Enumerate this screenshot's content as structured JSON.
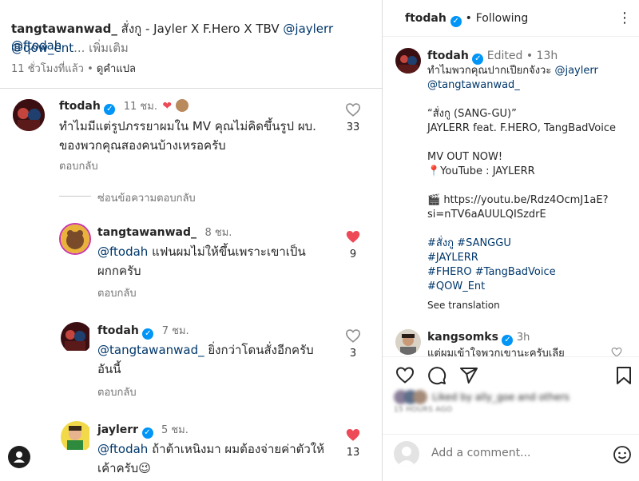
{
  "left": {
    "caption": {
      "author": "tangtawanwad_",
      "text": "สั่งกู - Jayler X F.Hero X TBV",
      "mention1": "@jaylerr",
      "mention2": "@ftodah",
      "mention3": "@qow_ent",
      "more": "... เพิ่มเติม",
      "time": "11 ชั่วโมงที่แล้ว",
      "dot": "•",
      "translate": "ดูคำแปล"
    },
    "comments": [
      {
        "user": "ftodah",
        "time": "11 ชม.",
        "line1": "ทำไมมีแต่รูปภรรยาผมใน MV คุณไม่คิดขึ้นรูป ผบ.",
        "line2": "ของพวกคุณสองคนบ้างเหรอครับ",
        "reply": "ตอบกลับ",
        "likes": "33"
      }
    ],
    "hide_replies": "ซ่อนข้อความตอบกลับ",
    "replies": [
      {
        "user": "tangtawanwad_",
        "time": "8 ชม.",
        "mention": "@ftodah",
        "line1": " แฟนผมไม่ให้ขึ้นเพราะเขาเป็น",
        "line2": "ผกกครับ",
        "reply": "ตอบกลับ",
        "likes": "9"
      },
      {
        "user": "ftodah",
        "time": "7 ชม.",
        "mention": "@tangtawanwad_",
        "line1": " ยิ่งกว่าโดนสั่งอีกครับ",
        "line2": "อันนี้",
        "reply": "ตอบกลับ",
        "likes": "3"
      },
      {
        "user": "jaylerr",
        "time": "5 ชม.",
        "mention": "@ftodah",
        "line1": " ถ้าต้าเหนิงมา ผมต้องจ่ายค่าตัวให้",
        "line2": "เค้าครับ",
        "emoji": "😉",
        "likes": "13"
      }
    ]
  },
  "right": {
    "header": {
      "user": "ftodah",
      "follow": "Following"
    },
    "post": {
      "user": "ftodah",
      "edited": "Edited",
      "dot": "•",
      "time": "13h",
      "l1": "ทำไมพวกคุณปากเปียกจังวะ ",
      "l1mention": "@jaylerr",
      "l2mention": "@tangtawanwad_",
      "l3": "“สั่งกู (SANG-GU)”",
      "l4": "JAYLERR feat. F.HERO, TangBadVoice",
      "l5": "MV OUT NOW!",
      "l6": "📍YouTube : JAYLERR",
      "l7": "🎬  https://youtu.be/Rdz4OcmJ1aE?",
      "l8": "si=nTV6aAUULQISzdrE",
      "tags1": "#สั่งกู #SANGGU",
      "tags2": "#JAYLERR",
      "tags3": "#FHERO #TangBadVoice",
      "tags4": "#QOW_Ent",
      "see_translation": "See translation"
    },
    "comment": {
      "user": "kangsomks",
      "time": "3h",
      "text": "แต่ผมเข้าใจพวกเขานะครับเลีย"
    },
    "likes_text": "Liked by ally_goe and others",
    "ago": "15 HOURS AGO",
    "add_comment": "Add a comment..."
  }
}
